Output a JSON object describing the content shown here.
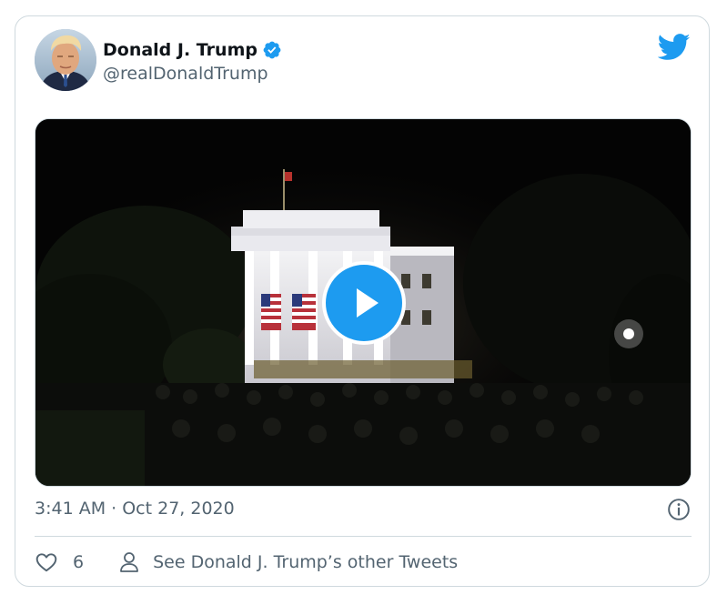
{
  "tweet": {
    "author": {
      "display_name": "Donald J. Trump",
      "handle": "@realDonaldTrump",
      "verified": true,
      "avatar_icon": "avatar-photo"
    },
    "brand_icon": "twitter-bird-icon",
    "media": {
      "type": "video",
      "play_icon": "play-icon"
    },
    "timestamp": "3:41 AM · Oct 27, 2020",
    "actions": {
      "like_count": "6",
      "profile_link_label": "See Donald J. Trump’s other Tweets"
    }
  },
  "colors": {
    "brand_blue": "#1d9bf0",
    "text_primary": "#0f1419",
    "text_secondary": "#536471",
    "border": "#cfd9de"
  }
}
